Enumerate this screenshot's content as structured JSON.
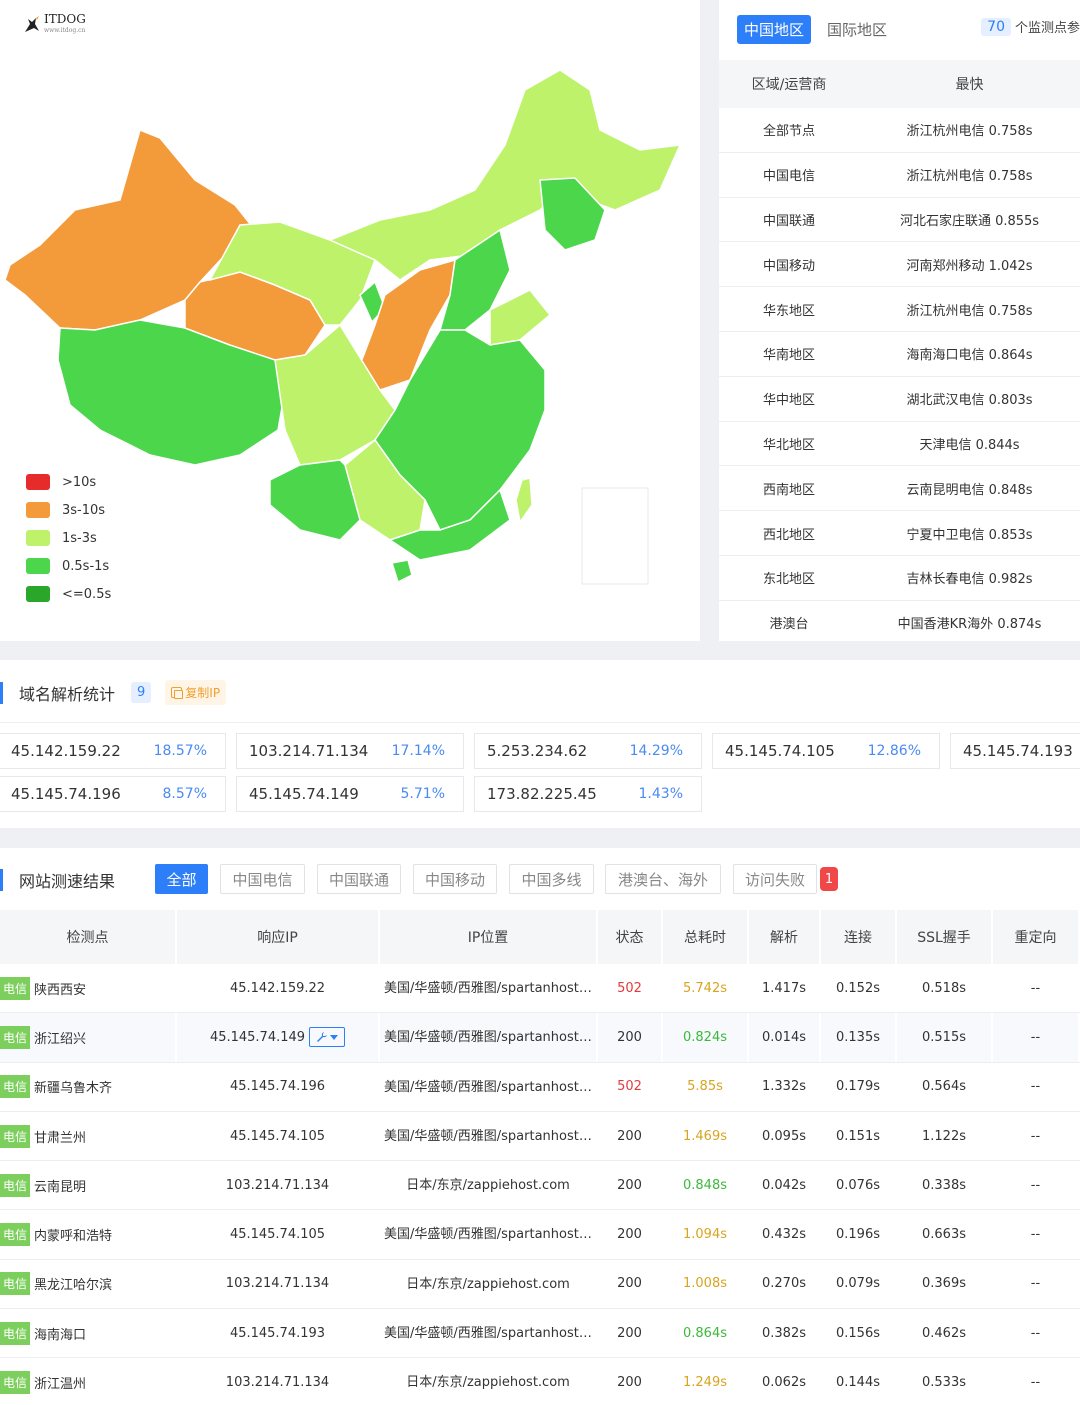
{
  "colors": {
    "accent": "#2d7ff9",
    "legend": [
      "#e62b2b",
      "#f39a3b",
      "#bdf26a",
      "#4cd64c",
      "#2aa62a"
    ]
  },
  "logo": {
    "text": "ITDOG",
    "sub": "www.itdog.cn"
  },
  "legend": [
    ">10s",
    "3s-10s",
    "1s-3s",
    "0.5s-1s",
    "<=0.5s"
  ],
  "region_tabs": {
    "active": "中国地区",
    "other": "国际地区"
  },
  "monitor": {
    "count": "70",
    "label": "个监测点参"
  },
  "fastest": {
    "headers": [
      "区域/运营商",
      "最快"
    ],
    "rows": [
      [
        "全部节点",
        "浙江杭州电信 0.758s"
      ],
      [
        "中国电信",
        "浙江杭州电信 0.758s"
      ],
      [
        "中国联通",
        "河北石家庄联通 0.855s"
      ],
      [
        "中国移动",
        "河南郑州移动 1.042s"
      ],
      [
        "华东地区",
        "浙江杭州电信 0.758s"
      ],
      [
        "华南地区",
        "海南海口电信 0.864s"
      ],
      [
        "华中地区",
        "湖北武汉电信 0.803s"
      ],
      [
        "华北地区",
        "天津电信 0.844s"
      ],
      [
        "西南地区",
        "云南昆明电信 0.848s"
      ],
      [
        "西北地区",
        "宁夏中卫电信 0.853s"
      ],
      [
        "东北地区",
        "吉林长春电信 0.982s"
      ],
      [
        "港澳台",
        "中国香港KR海外 0.874s"
      ]
    ]
  },
  "dns": {
    "title": "域名解析统计",
    "count": "9",
    "copy_label": "复制IP",
    "ips": [
      {
        "ip": "45.142.159.22",
        "pct": "18.57%"
      },
      {
        "ip": "103.214.71.134",
        "pct": "17.14%"
      },
      {
        "ip": "5.253.234.62",
        "pct": "14.29%"
      },
      {
        "ip": "45.145.74.105",
        "pct": "12.86%"
      },
      {
        "ip": "45.145.74.193",
        "pct": ""
      },
      {
        "ip": "45.145.74.196",
        "pct": "8.57%"
      },
      {
        "ip": "45.145.74.149",
        "pct": "5.71%"
      },
      {
        "ip": "173.82.225.45",
        "pct": "1.43%"
      }
    ]
  },
  "results": {
    "title": "网站测速结果",
    "filters": [
      "全部",
      "中国电信",
      "中国联通",
      "中国移动",
      "中国多线",
      "港澳台、海外",
      "访问失败"
    ],
    "fail_count": "1",
    "headers": [
      "检测点",
      "响应IP",
      "IP位置",
      "状态",
      "总耗时",
      "解析",
      "连接",
      "SSL握手",
      "重定向"
    ],
    "isp": "电信",
    "rows": [
      {
        "node": "陕西西安",
        "ip": "45.142.159.22",
        "loc": "美国/华盛顿/西雅图/spartanhost.net",
        "status": "502",
        "total": "5.742s",
        "dns": "1.417s",
        "conn": "0.152s",
        "ssl": "0.518s",
        "redir": "--"
      },
      {
        "node": "浙江绍兴",
        "ip": "45.145.74.149",
        "loc": "美国/华盛顿/西雅图/spartanhost.net",
        "status": "200",
        "total": "0.824s",
        "dns": "0.014s",
        "conn": "0.135s",
        "ssl": "0.515s",
        "redir": "--"
      },
      {
        "node": "新疆乌鲁木齐",
        "ip": "45.145.74.196",
        "loc": "美国/华盛顿/西雅图/spartanhost.net",
        "status": "502",
        "total": "5.85s",
        "dns": "1.332s",
        "conn": "0.179s",
        "ssl": "0.564s",
        "redir": "--"
      },
      {
        "node": "甘肃兰州",
        "ip": "45.145.74.105",
        "loc": "美国/华盛顿/西雅图/spartanhost.net",
        "status": "200",
        "total": "1.469s",
        "dns": "0.095s",
        "conn": "0.151s",
        "ssl": "1.122s",
        "redir": "--"
      },
      {
        "node": "云南昆明",
        "ip": "103.214.71.134",
        "loc": "日本/东京/zappiehost.com",
        "status": "200",
        "total": "0.848s",
        "dns": "0.042s",
        "conn": "0.076s",
        "ssl": "0.338s",
        "redir": "--"
      },
      {
        "node": "内蒙呼和浩特",
        "ip": "45.145.74.105",
        "loc": "美国/华盛顿/西雅图/spartanhost.net",
        "status": "200",
        "total": "1.094s",
        "dns": "0.432s",
        "conn": "0.196s",
        "ssl": "0.663s",
        "redir": "--"
      },
      {
        "node": "黑龙江哈尔滨",
        "ip": "103.214.71.134",
        "loc": "日本/东京/zappiehost.com",
        "status": "200",
        "total": "1.008s",
        "dns": "0.270s",
        "conn": "0.079s",
        "ssl": "0.369s",
        "redir": "--"
      },
      {
        "node": "海南海口",
        "ip": "45.145.74.193",
        "loc": "美国/华盛顿/西雅图/spartanhost.net",
        "status": "200",
        "total": "0.864s",
        "dns": "0.382s",
        "conn": "0.156s",
        "ssl": "0.462s",
        "redir": "--"
      },
      {
        "node": "浙江温州",
        "ip": "103.214.71.134",
        "loc": "日本/东京/zappiehost.com",
        "status": "200",
        "total": "1.249s",
        "dns": "0.062s",
        "conn": "0.144s",
        "ssl": "0.533s",
        "redir": "--"
      }
    ]
  }
}
